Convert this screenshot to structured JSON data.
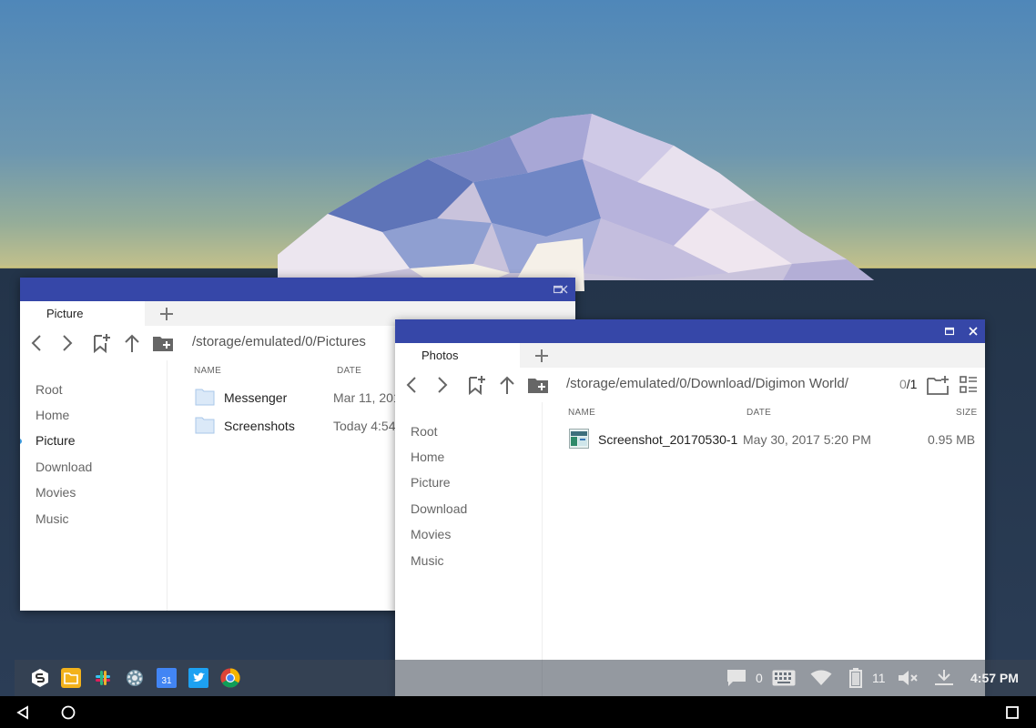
{
  "colors": {
    "titlebar": "#3647a8",
    "accent": "#3b9be0",
    "folder": "#c8ddf4",
    "taskbar": "#3c4652"
  },
  "window_picture": {
    "tab_label": "Picture",
    "path": "/storage/emulated/0/Pictures",
    "sidebar": [
      "Root",
      "Home",
      "Picture",
      "Download",
      "Movies",
      "Music"
    ],
    "active_sidebar": "Picture",
    "columns": {
      "name": "NAME",
      "date": "DATE"
    },
    "rows": [
      {
        "name": "Messenger",
        "date": "Mar 11, 2017",
        "icon": "folder-icon"
      },
      {
        "name": "Screenshots",
        "date": "Today 4:54 PM",
        "icon": "folder-icon"
      }
    ]
  },
  "window_photos": {
    "tab_label": "Photos",
    "path": "/storage/emulated/0/Download/Digimon World/",
    "count": "0",
    "count_total": "/1",
    "sidebar": [
      "Root",
      "Home",
      "Picture",
      "Download",
      "Movies",
      "Music"
    ],
    "columns": {
      "name": "NAME",
      "date": "DATE",
      "size": "SIZE"
    },
    "rows": [
      {
        "name": "Screenshot_20170530-1",
        "date": "May 30, 2017 5:20 PM",
        "size": "0.95 MB",
        "icon": "image-thumbnail-icon"
      }
    ]
  },
  "taskbar": {
    "apps": [
      "start-menu-icon",
      "file-manager-icon",
      "slack-icon",
      "settings-icon",
      "calendar-icon",
      "twitter-icon",
      "chrome-icon"
    ],
    "calendar_day": "31",
    "notifications_count": "0",
    "battery_level": "11",
    "time": "4:57 PM"
  }
}
